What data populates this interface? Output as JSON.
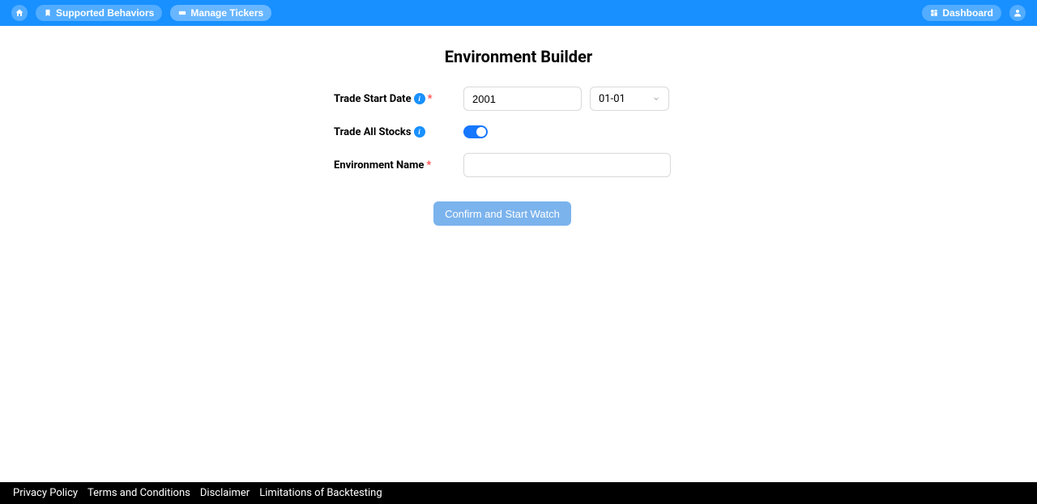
{
  "navbar": {
    "left_items": [
      {
        "label": "Supported Behaviors"
      },
      {
        "label": "Manage Tickers"
      }
    ],
    "right_items": [
      {
        "label": "Dashboard"
      }
    ]
  },
  "page": {
    "title": "Environment Builder"
  },
  "form": {
    "trade_start_date": {
      "label": "Trade Start Date",
      "year_value": "2001",
      "date_value": "01-01"
    },
    "trade_all_stocks": {
      "label": "Trade All Stocks",
      "value": true
    },
    "environment_name": {
      "label": "Environment Name",
      "value": ""
    },
    "submit_label": "Confirm and Start Watch"
  },
  "footer": {
    "links": [
      "Privacy Policy",
      "Terms and Conditions",
      "Disclaimer",
      "Limitations of Backtesting"
    ]
  }
}
